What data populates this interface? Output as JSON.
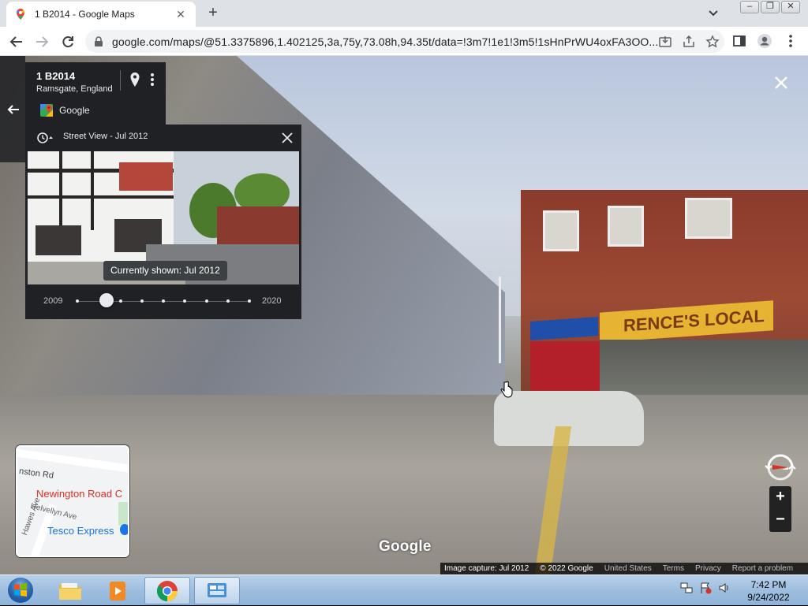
{
  "browser": {
    "tab_title": "1 B2014 - Google Maps",
    "url": "google.com/maps/@51.3375896,1.402125,3a,75y,73.08h,94.35t/data=!3m7!1e1!3m5!1sHnPrWU4oxFA3OO..."
  },
  "place": {
    "title": "1 B2014",
    "subtitle": "Ramsgate, England",
    "source": "Google"
  },
  "time_machine": {
    "label": "Street View - Jul 2012",
    "tooltip": "Currently shown: Jul 2012",
    "year_start": "2009",
    "year_end": "2020",
    "selected_index": 1,
    "dot_count": 9
  },
  "minimap": {
    "road1": "nston Rd",
    "place1": "Newington Road C",
    "road2": "Helvellyn Ave",
    "road3": "Hawes Ave",
    "place2": "Tesco Express"
  },
  "scene": {
    "shop_sign": "RENCE'S LOCAL",
    "watermark": "Google"
  },
  "footer": {
    "capture": "Image capture: Jul 2012",
    "copyright": "© 2022 Google",
    "country": "United States",
    "terms": "Terms",
    "privacy": "Privacy",
    "report": "Report a problem"
  },
  "taskbar": {
    "time": "7:42 PM",
    "date": "9/24/2022"
  },
  "colors": {
    "panel_bg": "#202124",
    "accent_red": "#d93025",
    "accent_blue": "#1a73e8"
  }
}
